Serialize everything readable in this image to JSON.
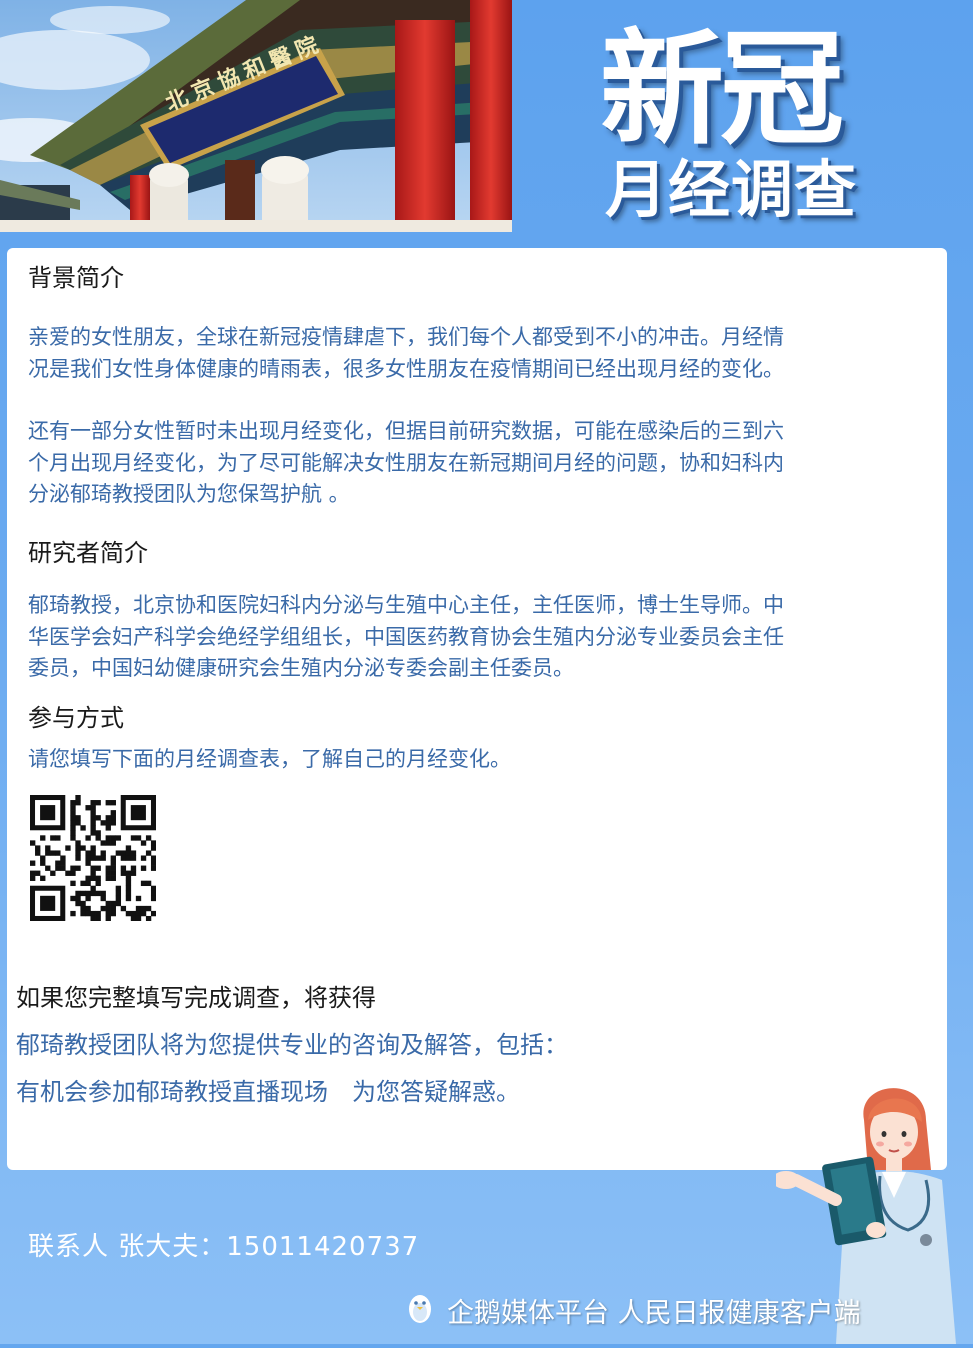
{
  "title": {
    "main": "新冠",
    "sub": "月经调查"
  },
  "banner": {
    "plaque_text": "北京協和醫院"
  },
  "sections": {
    "background": {
      "heading": "背景简介",
      "para1": [
        "亲爱的女性朋友，全球在新冠疫情肆虐下，我们每个人都受到不小的冲击。月经情",
        "况是我们女性身体健康的晴雨表，很多女性朋友在疫情期间已经出现月经的变化。"
      ],
      "para2": [
        "还有一部分女性暂时未出现月经变化，但据目前研究数据，可能在感染后的三到六",
        "个月出现月经变化，为了尽可能解决女性朋友在新冠期间月经的问题，协和妇科内",
        "分泌郁琦教授团队为您保驾护航 。"
      ]
    },
    "researcher": {
      "heading": "研究者简介",
      "para": [
        "郁琦教授，北京协和医院妇科内分泌与生殖中心主任，主任医师，博士生导师。中",
        "华医学会妇产科学会绝经学组组长，中国医药教育协会生殖内分泌专业委员会主任",
        "委员，中国妇幼健康研究会生殖内分泌专委会副主任委员。"
      ]
    },
    "participate": {
      "heading": "参与方式",
      "para": "请您填写下面的月经调查表，了解自己的月经变化。"
    },
    "benefits": {
      "lead": "如果您完整填写完成调查，将获得",
      "line1": "郁琦教授团队将为您提供专业的咨询及解答，包括：",
      "line2": "有机会参加郁琦教授直播现场　为您答疑解惑。"
    }
  },
  "contact": "联系人 张大夫：15011420737",
  "watermark": {
    "text": "企鹅媒体平台 人民日报健康客户端",
    "icon": "penguin-icon"
  },
  "colors": {
    "background": "#64a6ee",
    "body_text_blue": "#3a6aa8",
    "heading_text": "#1a1a1a",
    "card": "#ffffff",
    "pillar_red": "#d92a2a"
  },
  "icons": [
    "qr-code",
    "penguin-icon",
    "nurse-illustration"
  ]
}
